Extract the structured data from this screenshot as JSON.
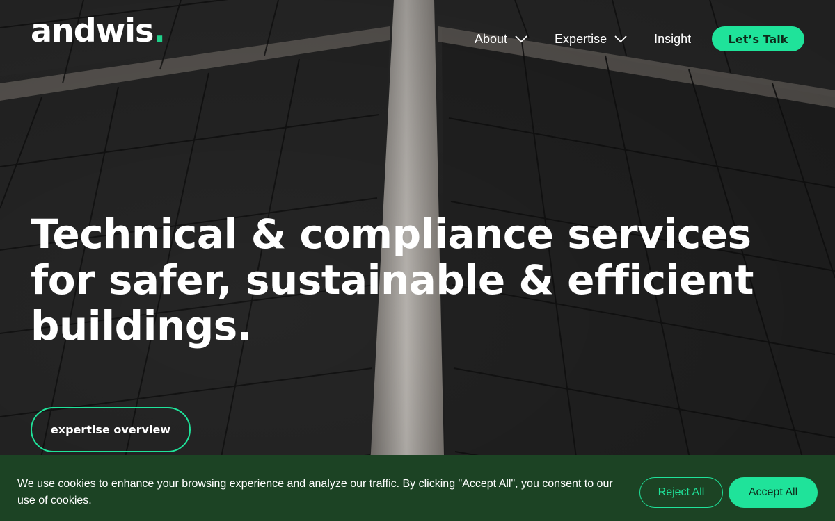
{
  "header": {
    "logo_text": "andwis",
    "logo_dot": ".",
    "nav": [
      {
        "label": "About",
        "has_dropdown": true,
        "icon": "chevron-down-icon"
      },
      {
        "label": "Expertise",
        "has_dropdown": true,
        "icon": "chevron-down-icon"
      },
      {
        "label": "Insight",
        "has_dropdown": false
      }
    ],
    "cta_label": "Let’s Talk"
  },
  "hero": {
    "headline": "Technical & compliance services for safer, sustainable & efficient buildings.",
    "button_label": "expertise overview",
    "background": "solar-panels-photo"
  },
  "cookie_banner": {
    "text": "We use cookies to enhance your browsing experience and analyze our traffic. By clicking \"Accept All\", you consent to our use of cookies.",
    "reject_label": "Reject All",
    "accept_label": "Accept All"
  },
  "colors": {
    "accent": "#1fe39a",
    "cookie_bg": "#1c4324"
  }
}
